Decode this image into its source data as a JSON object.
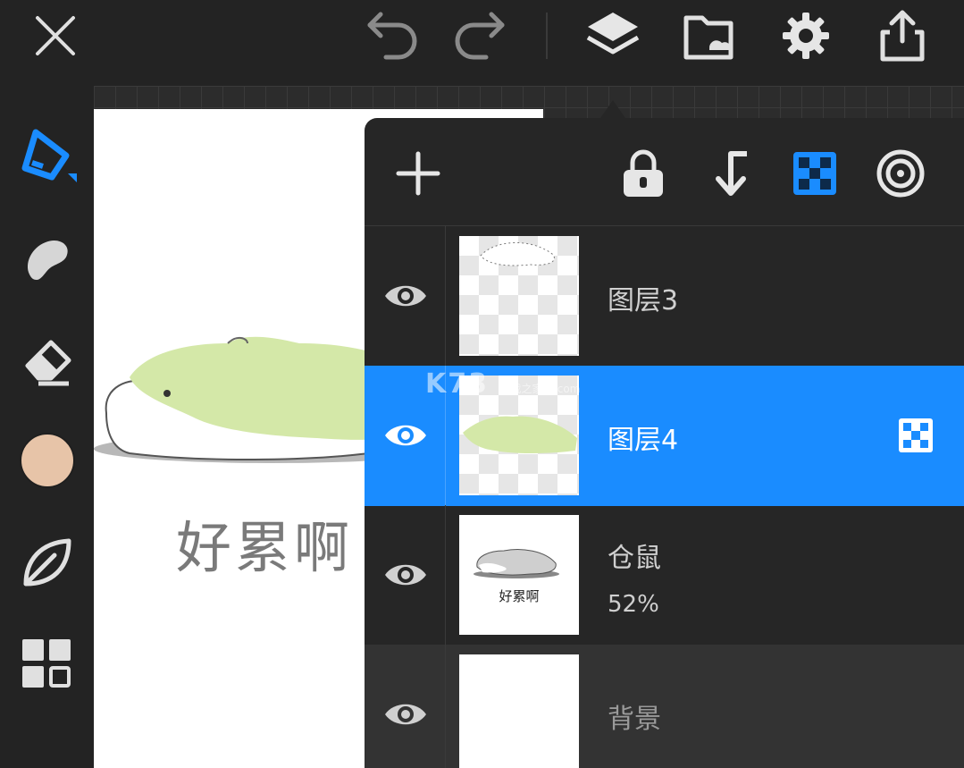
{
  "topbar": {
    "icons": [
      "close-icon",
      "undo-icon",
      "redo-icon",
      "layers-icon",
      "folder-cloud-icon",
      "gear-icon",
      "share-icon"
    ]
  },
  "left_toolbar": {
    "icons": [
      "pen-icon",
      "smudge-icon",
      "eraser-icon",
      "color-swatch",
      "leaf-icon",
      "grid-icon"
    ],
    "current_color": "#e7c4a8"
  },
  "canvas": {
    "text": "好累啊"
  },
  "layers_panel": {
    "header_icons": [
      "add-icon",
      "lock-icon",
      "merge-down-icon",
      "alpha-lock-icon",
      "blend-icon"
    ],
    "layers": [
      {
        "name": "图层3",
        "opacity": "",
        "visible": true,
        "selected": false
      },
      {
        "name": "图层4",
        "opacity": "",
        "visible": true,
        "selected": true
      },
      {
        "name": "仓鼠",
        "opacity": "52%",
        "visible": true,
        "selected": false,
        "thumb_text": "好累啊"
      },
      {
        "name": "背景",
        "opacity": "",
        "visible": true,
        "selected": false
      }
    ]
  },
  "watermark": {
    "main": "K73",
    "sub1": "游戏之家",
    "sub2": ".com"
  },
  "colors": {
    "accent": "#1a8cff",
    "background": "#232323",
    "hamster_green": "#d4e8a8"
  }
}
